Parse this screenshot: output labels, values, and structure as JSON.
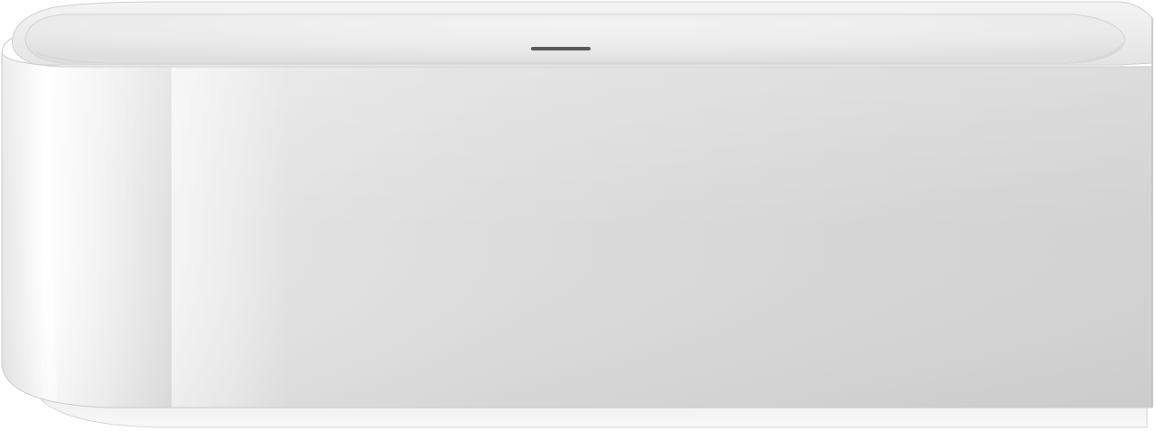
{
  "image": {
    "subject": "bathtub-product-render",
    "background_color": "#ffffff",
    "tub_body_color": "#d9d9d9",
    "tub_highlight_color": "#f7f7f7",
    "basin_color": "#efefef",
    "drain_color": "#5a5a5a",
    "plinth_color": "#f4f4f4"
  }
}
